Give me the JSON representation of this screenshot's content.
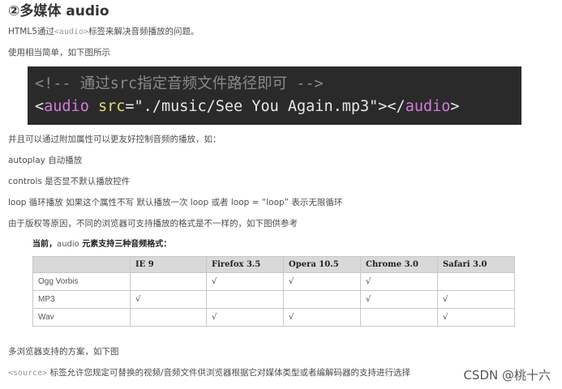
{
  "heading": "②多媒体 audio",
  "para1": {
    "before": "HTML5通过",
    "code": "<audio>",
    "after": "标签来解决音频播放的问题。"
  },
  "para2": "使用相当简单，如下图所示",
  "code_image": {
    "comment": "<!-- 通过src指定音频文件路径即可 -->",
    "open_lt": "<",
    "tag_name": "audio",
    "attr": " src",
    "value": "=\"./music/See You Again.mp3\">",
    "close_lt": "</",
    "close_tag": "audio",
    "close_gt": ">"
  },
  "para3": "并且可以通过附加属性可以更友好控制音频的播放，如：",
  "para4": "autoplay 自动播放",
  "para5": "controls 是否显不默认播放控件",
  "para6": "loop 循环播放    如果这个属性不写 默认播放一次      loop  或者  loop = “loop”   表示无限循环",
  "para7": "由于版权等原因，不同的浏览器可支持播放的格式是不一样的，如下图供参考",
  "table_caption": {
    "before": "当前，",
    "em": "audio",
    "after": " 元素支持三种音频格式："
  },
  "table": {
    "headers": [
      "",
      "IE 9",
      "Firefox 3.5",
      "Opera 10.5",
      "Chrome 3.0",
      "Safari 3.0"
    ],
    "rows": [
      [
        "Ogg Vorbis",
        "",
        "√",
        "√",
        "√",
        ""
      ],
      [
        "MP3",
        "√",
        "",
        "",
        "√",
        "√"
      ],
      [
        "Wav",
        "",
        "√",
        "√",
        "",
        "√"
      ]
    ]
  },
  "para8": "多浏览器支持的方案，如下图",
  "para9": {
    "code": "<source>",
    "after": " 标签允许您规定可替换的视频/音频文件供浏览器根据它对媒体类型或者编解码器的支持进行选择"
  },
  "watermark": "CSDN @桃十六"
}
